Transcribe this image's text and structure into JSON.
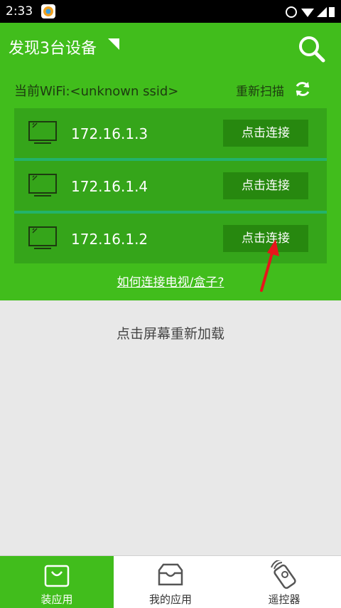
{
  "status_bar": {
    "time": "2:33"
  },
  "header": {
    "title": "发现3台设备"
  },
  "wifi": {
    "label": "当前WiFi:<unknown ssid>",
    "rescan_label": "重新扫描"
  },
  "devices": [
    {
      "ip": "172.16.1.3",
      "button": "点击连接"
    },
    {
      "ip": "172.16.1.4",
      "button": "点击连接"
    },
    {
      "ip": "172.16.1.2",
      "button": "点击连接"
    }
  ],
  "help_link": "如何连接电视/盒子?",
  "reload_text": "点击屏幕重新加载",
  "bottom_nav": [
    {
      "label": "装应用",
      "icon": "shopping-bag-icon",
      "active": true
    },
    {
      "label": "我的应用",
      "icon": "inbox-tray-icon",
      "active": false
    },
    {
      "label": "遥控器",
      "icon": "remote-control-icon",
      "active": false
    }
  ],
  "colors": {
    "primary_green": "#41bd1c",
    "row_green": "#35a51a",
    "button_green": "#27880f",
    "divider": "#23b36b",
    "annotation_arrow": "#e8141b"
  }
}
